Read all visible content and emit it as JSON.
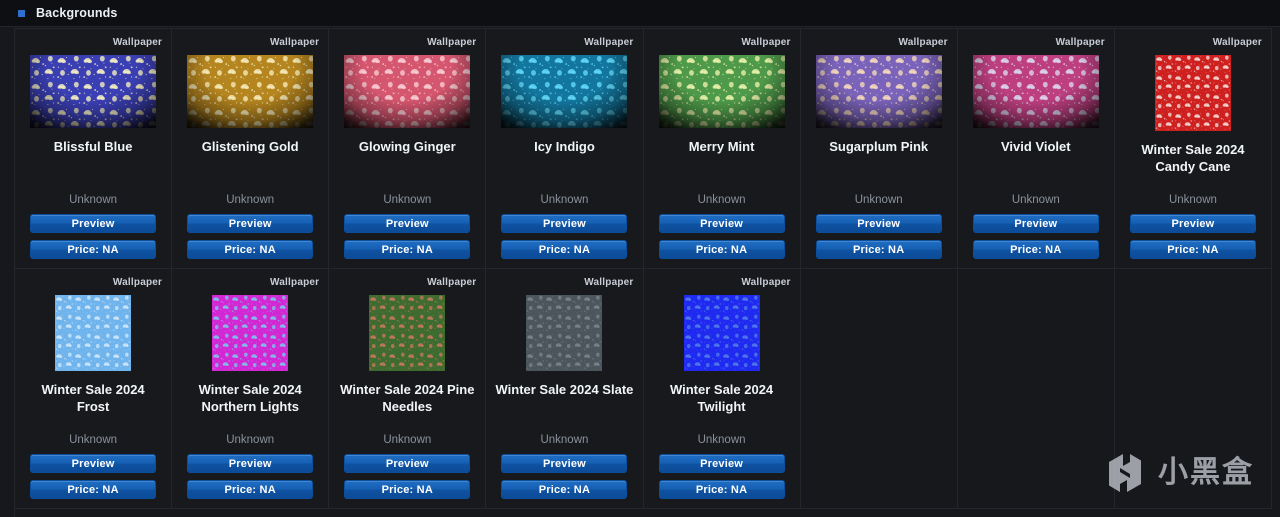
{
  "header": {
    "title": "Backgrounds",
    "marker_color": "#2f6fd0",
    "icon": "square-marker-icon"
  },
  "labels": {
    "kind": "Wallpaper",
    "preview_button": "Preview",
    "price_button": "Price: NA",
    "unknown": "Unknown"
  },
  "watermark": {
    "text": "小黑盒",
    "icon": "heybox-logo-icon"
  },
  "theme": {
    "page_background": "#16181c",
    "header_background": "#0d0f12",
    "grid_line": "#23262c",
    "button_blue": "#1761b4",
    "title_text": "#f2f5f8",
    "muted_text": "#8b929c"
  },
  "grid": {
    "columns": 8,
    "rows": 2
  },
  "items": [
    {
      "title": "Blissful Blue",
      "kind": "Wallpaper",
      "owner": "Unknown",
      "preview_label": "Preview",
      "price_label": "Price: NA",
      "thumb_shape": "wide",
      "base_color": "#3b3fb4",
      "accent_color": "#f2eec2"
    },
    {
      "title": "Glistening Gold",
      "kind": "Wallpaper",
      "owner": "Unknown",
      "preview_label": "Preview",
      "price_label": "Price: NA",
      "thumb_shape": "wide",
      "base_color": "#b5851f",
      "accent_color": "#f5e9b8"
    },
    {
      "title": "Glowing Ginger",
      "kind": "Wallpaper",
      "owner": "Unknown",
      "preview_label": "Preview",
      "price_label": "Price: NA",
      "thumb_shape": "wide",
      "base_color": "#d5566f",
      "accent_color": "#f7ccd2"
    },
    {
      "title": "Icy Indigo",
      "kind": "Wallpaper",
      "owner": "Unknown",
      "preview_label": "Preview",
      "price_label": "Price: NA",
      "thumb_shape": "wide",
      "base_color": "#13769e",
      "accent_color": "#5fd8f5"
    },
    {
      "title": "Merry Mint",
      "kind": "Wallpaper",
      "owner": "Unknown",
      "preview_label": "Preview",
      "price_label": "Price: NA",
      "thumb_shape": "wide",
      "base_color": "#4f9a4a",
      "accent_color": "#e8f0a8"
    },
    {
      "title": "Sugarplum Pink",
      "kind": "Wallpaper",
      "owner": "Unknown",
      "preview_label": "Preview",
      "price_label": "Price: NA",
      "thumb_shape": "wide",
      "base_color": "#7a63ba",
      "accent_color": "#f3d7bc"
    },
    {
      "title": "Vivid Violet",
      "kind": "Wallpaper",
      "owner": "Unknown",
      "preview_label": "Preview",
      "price_label": "Price: NA",
      "thumb_shape": "wide",
      "base_color": "#bd3f80",
      "accent_color": "#dcd4ef"
    },
    {
      "title": "Winter Sale 2024 Candy Cane",
      "kind": "Wallpaper",
      "owner": "Unknown",
      "preview_label": "Preview",
      "price_label": "Price: NA",
      "thumb_shape": "square",
      "base_color": "#cf2020",
      "accent_color": "#f3d6d3"
    },
    {
      "title": "Winter Sale 2024 Frost",
      "kind": "Wallpaper",
      "owner": "Unknown",
      "preview_label": "Preview",
      "price_label": "Price: NA",
      "thumb_shape": "square",
      "base_color": "#6fb4ec",
      "accent_color": "#cfe7fb"
    },
    {
      "title": "Winter Sale 2024 Northern Lights",
      "kind": "Wallpaper",
      "owner": "Unknown",
      "preview_label": "Preview",
      "price_label": "Price: NA",
      "thumb_shape": "square",
      "base_color": "#d327d3",
      "accent_color": "#7fc2e8"
    },
    {
      "title": "Winter Sale 2024 Pine Needles",
      "kind": "Wallpaper",
      "owner": "Unknown",
      "preview_label": "Preview",
      "price_label": "Price: NA",
      "thumb_shape": "square",
      "base_color": "#3e6b2f",
      "accent_color": "#c4785a"
    },
    {
      "title": "Winter Sale 2024 Slate",
      "kind": "Wallpaper",
      "owner": "Unknown",
      "preview_label": "Preview",
      "price_label": "Price: NA",
      "thumb_shape": "square",
      "base_color": "#4c545c",
      "accent_color": "#79828b"
    },
    {
      "title": "Winter Sale 2024 Twilight",
      "kind": "Wallpaper",
      "owner": "Unknown",
      "preview_label": "Preview",
      "price_label": "Price: NA",
      "thumb_shape": "square",
      "base_color": "#1f29f0",
      "accent_color": "#4f7ae8"
    }
  ]
}
